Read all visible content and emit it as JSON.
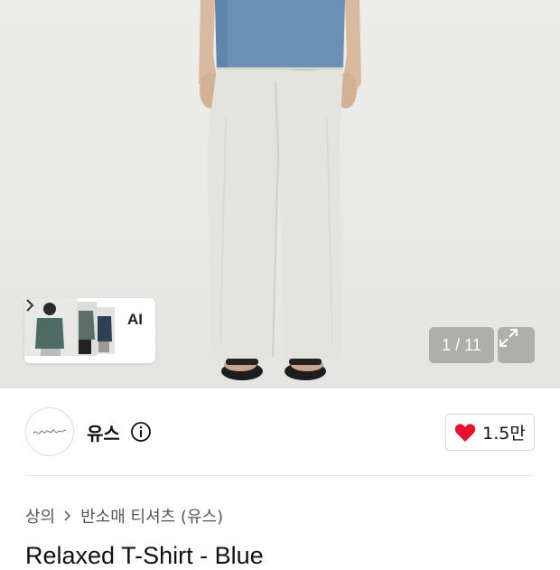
{
  "gallery": {
    "current": "1",
    "total": "11",
    "counter_text": "1 / 11",
    "ai_label": "AI",
    "icons": [
      "chevron-right-icon",
      "expand-icon"
    ]
  },
  "brand": {
    "name": "유스",
    "logo_text": "youth",
    "likes": "1.5만",
    "icons": [
      "info-icon",
      "heart-icon"
    ]
  },
  "breadcrumb": {
    "items": [
      "상의",
      "반소매 티셔츠 (유스)"
    ],
    "separator_icon": "chevron-right-icon"
  },
  "product": {
    "title": "Relaxed T-Shirt - Blue"
  },
  "colors": {
    "heart": "#e8112d",
    "shirt": "#6a90b3",
    "pants": "#e3e4de",
    "counter_bg": "#8a8a8a"
  }
}
